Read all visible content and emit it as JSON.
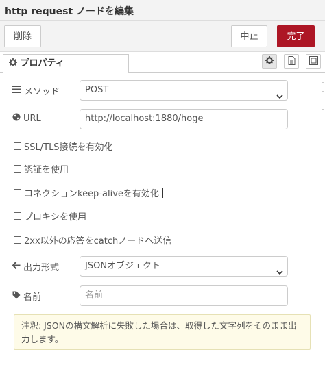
{
  "header": {
    "title": "http request ノードを編集"
  },
  "toolbar": {
    "delete_label": "削除",
    "cancel_label": "中止",
    "done_label": "完了"
  },
  "tabs": {
    "properties_label": "プロパティ"
  },
  "form": {
    "method": {
      "label": "メソッド",
      "value": "POST"
    },
    "url": {
      "label": "URL",
      "value": "http://localhost:1880/hoge"
    },
    "checkboxes": [
      {
        "label": "SSL/TLS接続を有効化",
        "checked": false
      },
      {
        "label": "認証を使用",
        "checked": false
      },
      {
        "label": "コネクションkeep-aliveを有効化",
        "checked": false
      },
      {
        "label": "プロキシを使用",
        "checked": false
      },
      {
        "label": "2xx以外の応答をcatchノードへ送信",
        "checked": false
      }
    ],
    "output": {
      "label": "出力形式",
      "value": "JSONオブジェクト"
    },
    "name": {
      "label": "名前",
      "placeholder": "名前",
      "value": ""
    }
  },
  "tip": {
    "text": "注釈: JSONの構文解析に失敗した場合は、取得した文字列をそのまま出力します。"
  },
  "colors": {
    "accent": "#ad1625",
    "tip_background": "#fefbe8"
  },
  "icons": [
    "cog-icon",
    "document-icon",
    "image-frame-icon",
    "list-icon",
    "globe-icon",
    "arrow-left-icon",
    "tag-icon",
    "chevron-down-icon"
  ]
}
